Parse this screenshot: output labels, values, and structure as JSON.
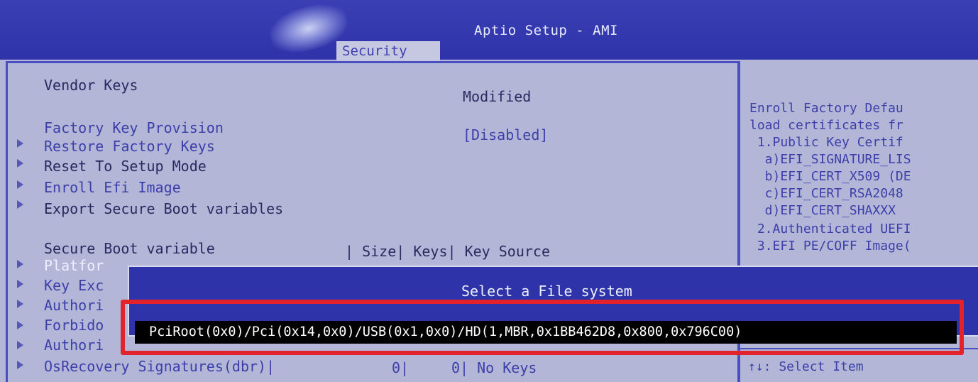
{
  "header": {
    "app_title": "Aptio Setup - AMI",
    "active_tab": "Security"
  },
  "main": {
    "vendor_keys_label": "Vendor Keys",
    "vendor_keys_value": "Modified",
    "factory_key_provision_label": "Factory Key Provision",
    "factory_key_provision_value": "[Disabled]",
    "menu_items": [
      "Restore Factory Keys",
      "Reset To Setup Mode",
      "Enroll Efi Image",
      "Export Secure Boot variables"
    ],
    "table_header": {
      "variable": "Secure Boot variable",
      "columns": "| Size| Keys| Key Source"
    },
    "table_rows_partial": [
      "Platfor",
      "Key Exc",
      "Authori",
      "Forbido",
      "Authori"
    ],
    "last_row": {
      "name": "OsRecovery Signatures(dbr)|",
      "size": "0|",
      "keys": "0| No Keys"
    }
  },
  "help_panel": {
    "lines": [
      "Enroll Factory Defau",
      "load certificates fr",
      " 1.Public Key Certif",
      "  a)EFI_SIGNATURE_LIS",
      "  b)EFI_CERT_X509 (DE",
      "  c)EFI_CERT_RSA2048",
      "  d)EFI_CERT_SHAXXX",
      " 2.Authenticated UEFI",
      " 3.EFI PE/COFF Image("
    ],
    "nav_hint": "↑↓: Select Item"
  },
  "dialog": {
    "title": "Select a File system",
    "selected_option": "PciRoot(0x0)/Pci(0x14,0x0)/USB(0x1,0x0)/HD(1,MBR,0x1BB462D8,0x800,0x796C00)"
  },
  "colors": {
    "bios_blue": "#2f33a9",
    "panel_bg": "#b4b6d8",
    "highlight_red": "#e3232b"
  }
}
